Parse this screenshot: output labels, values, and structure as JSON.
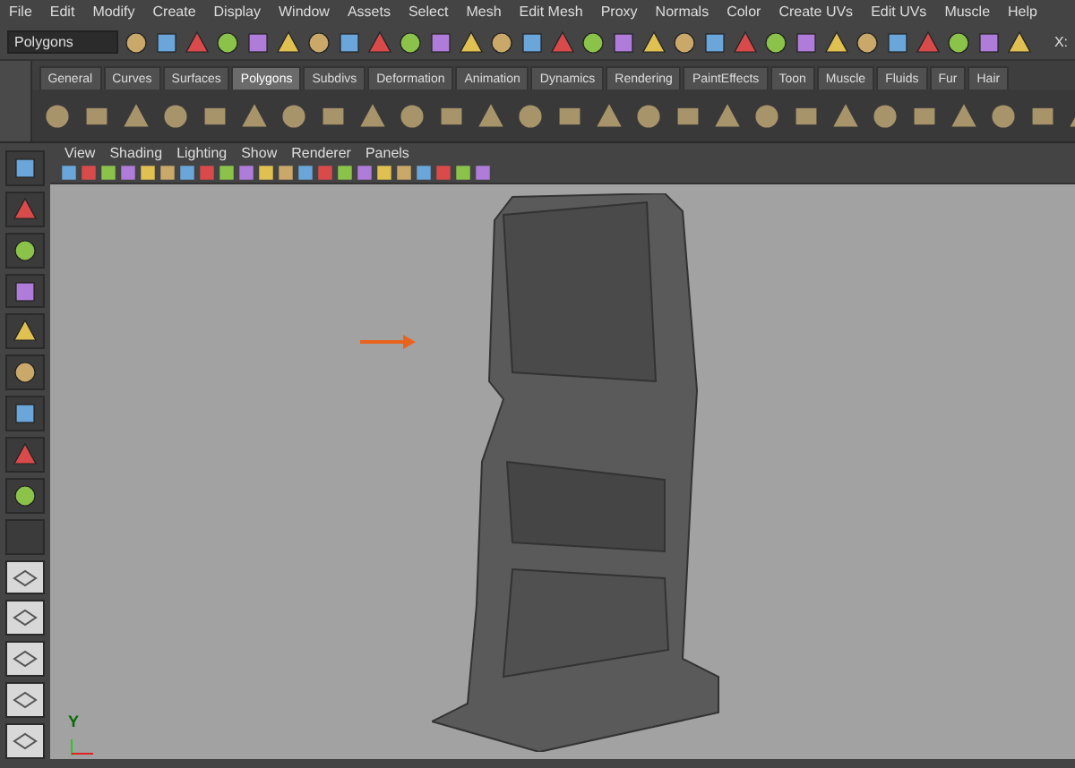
{
  "menu_bar": [
    "File",
    "Edit",
    "Modify",
    "Create",
    "Display",
    "Window",
    "Assets",
    "Select",
    "Mesh",
    "Edit Mesh",
    "Proxy",
    "Normals",
    "Color",
    "Create UVs",
    "Edit UVs",
    "Muscle",
    "Help"
  ],
  "status_line": {
    "menu_set": "Polygons",
    "coord_label": "X:"
  },
  "shelf_tabs": [
    {
      "label": "General",
      "selected": false
    },
    {
      "label": "Curves",
      "selected": false
    },
    {
      "label": "Surfaces",
      "selected": false
    },
    {
      "label": "Polygons",
      "selected": true
    },
    {
      "label": "Subdivs",
      "selected": false
    },
    {
      "label": "Deformation",
      "selected": false
    },
    {
      "label": "Animation",
      "selected": false
    },
    {
      "label": "Dynamics",
      "selected": false
    },
    {
      "label": "Rendering",
      "selected": false
    },
    {
      "label": "PaintEffects",
      "selected": false
    },
    {
      "label": "Toon",
      "selected": false
    },
    {
      "label": "Muscle",
      "selected": false
    },
    {
      "label": "Fluids",
      "selected": false
    },
    {
      "label": "Fur",
      "selected": false
    },
    {
      "label": "Hair",
      "selected": false
    }
  ],
  "panel_menu": [
    "View",
    "Shading",
    "Lighting",
    "Show",
    "Renderer",
    "Panels"
  ],
  "viewport": {
    "axis_label": "Y"
  }
}
